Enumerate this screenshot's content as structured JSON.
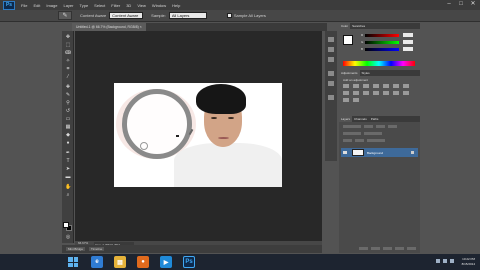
{
  "menu": {
    "logo": "Ps",
    "items": [
      "File",
      "Edit",
      "Image",
      "Layer",
      "Type",
      "Select",
      "Filter",
      "3D",
      "View",
      "Window",
      "Help"
    ]
  },
  "window_controls": [
    "–",
    "□",
    "✕"
  ],
  "options_bar": {
    "tool_preset_icon": "brush-icon",
    "mode_label": "Content Aware",
    "sample_label": "Sample:",
    "sample_value": "All Layers",
    "sample_all_label": "Sample All Layers"
  },
  "document_tab": {
    "title": "Untitled-1 @ 66.7% (Background, RGB/8) ×"
  },
  "status_bar": {
    "zoom": "66.67%",
    "info": "Doc: 2.25M/2.25M"
  },
  "mini_bridge": {
    "tabs": [
      "Mini Bridge",
      "Timeline"
    ]
  },
  "panels": {
    "color_tabs": [
      "Color",
      "Swatches"
    ],
    "sliders": [
      {
        "label": "R",
        "gradient": "linear-gradient(to right,#000,#f00)"
      },
      {
        "label": "G",
        "gradient": "linear-gradient(to right,#000,#0f0)"
      },
      {
        "label": "B",
        "gradient": "linear-gradient(to right,#000,#00f)"
      }
    ],
    "adjust_tabs": [
      "Adjustments",
      "Styles"
    ],
    "adjust_title": "Add an adjustment",
    "layers_tabs": [
      "Layers",
      "Channels",
      "Paths"
    ],
    "layer_name": "Background"
  },
  "taskbar": {
    "icons": [
      {
        "name": "ie-icon",
        "glyph": "e",
        "color": "#2f7cd4"
      },
      {
        "name": "folder-icon",
        "glyph": "▤",
        "color": "#e5b23a"
      },
      {
        "name": "firefox-icon",
        "glyph": "●",
        "color": "#e06a1d"
      },
      {
        "name": "media-icon",
        "glyph": "▶",
        "color": "#1f8ad9"
      },
      {
        "name": "photoshop-icon",
        "glyph": "Ps",
        "color": "#0d2a4d"
      }
    ],
    "time": "10:22 PM",
    "date": "8/15/2014"
  }
}
